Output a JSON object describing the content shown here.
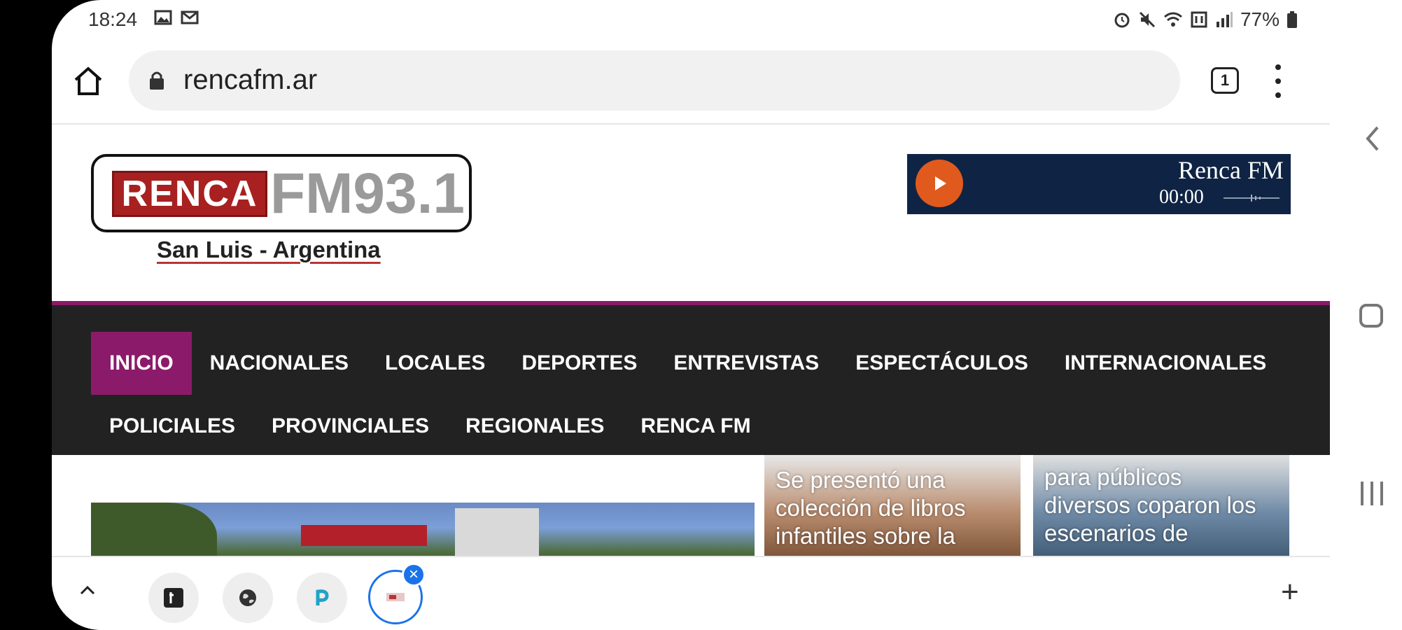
{
  "status_bar": {
    "time": "18:24",
    "left_icons": [
      "gallery-icon",
      "gmail-icon"
    ],
    "right_icons": [
      "alarm-icon",
      "mute-icon",
      "wifi-icon",
      "data-icon",
      "signal-icon"
    ],
    "battery": "77%"
  },
  "browser": {
    "url": "rencafm.ar",
    "tab_count": "1"
  },
  "site": {
    "logo_red": "RENCA",
    "logo_fm": "FM93.1",
    "tagline": "San Luis - Argentina",
    "player": {
      "title": "Renca FM",
      "time": "00:00"
    }
  },
  "nav": {
    "row1": [
      "INICIO",
      "NACIONALES",
      "LOCALES",
      "DEPORTES",
      "ENTREVISTAS",
      "ESPECTÁCULOS",
      "INTERNACIONALES"
    ],
    "row2": [
      "POLICIALES",
      "PROVINCIALES",
      "REGIONALES",
      "RENCA FM"
    ]
  },
  "cards": [
    {
      "title_lines": [
        "Se presentó una",
        "colección de libros",
        "infantiles sobre la"
      ]
    },
    {
      "title_lines": [
        "para públicos",
        "diversos coparon los",
        "escenarios de"
      ]
    }
  ],
  "tab_strip": {
    "tabs": [
      "T",
      "",
      "P",
      ""
    ],
    "colors": {
      "accent": "#1a73e8"
    }
  },
  "colors": {
    "nav_bg": "#222222",
    "nav_active": "#8c1a6a",
    "logo_red": "#a8201f",
    "player_bg": "#0f2444",
    "play_button": "#e05a1e"
  }
}
